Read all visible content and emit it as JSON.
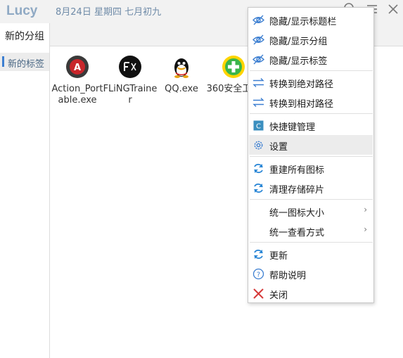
{
  "app": {
    "title": "Lucy",
    "date": "8月24日 星期四 七月初九"
  },
  "titlebar": {
    "icons": [
      "search-icon",
      "menu-icon",
      "close-icon"
    ]
  },
  "groups": [
    {
      "label": "新的分组"
    }
  ],
  "tabs": [
    {
      "label": "新的标签"
    }
  ],
  "apps": [
    {
      "name": "Action_Portable.exe",
      "icon": "action-app-icon"
    },
    {
      "name": "FLiNGTrainer",
      "icon": "fling-app-icon"
    },
    {
      "name": "QQ.exe",
      "icon": "qq-app-icon"
    },
    {
      "name": "360安全卫士",
      "icon": "360-app-icon"
    }
  ],
  "menu": {
    "items": [
      {
        "label": "隐藏/显示标题栏",
        "icon": "eye-icon"
      },
      {
        "label": "隐藏/显示分组",
        "icon": "eye-icon"
      },
      {
        "label": "隐藏/显示标签",
        "icon": "eye-icon"
      },
      {
        "label": "转换到绝对路径",
        "icon": "swap-icon"
      },
      {
        "label": "转换到相对路径",
        "icon": "swap-icon"
      },
      {
        "label": "快捷键管理",
        "icon": "shortcut-icon"
      },
      {
        "label": "设置",
        "icon": "gear-icon"
      },
      {
        "label": "重建所有图标",
        "icon": "refresh-icon"
      },
      {
        "label": "清理存储碎片",
        "icon": "refresh-icon"
      },
      {
        "label": "统一图标大小",
        "icon": ""
      },
      {
        "label": "统一查看方式",
        "icon": ""
      },
      {
        "label": "更新",
        "icon": "update-icon"
      },
      {
        "label": "帮助说明",
        "icon": "help-icon"
      },
      {
        "label": "关闭",
        "icon": "close-x-icon"
      }
    ]
  },
  "colors": {
    "accent": "#3d7fd1",
    "title": "#8fa9c4",
    "hover": "#ececec"
  }
}
